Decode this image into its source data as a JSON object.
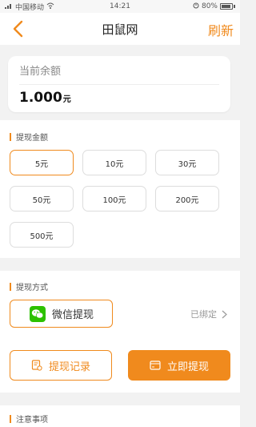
{
  "status_bar": {
    "carrier": "中国移动",
    "time": "14:21",
    "battery": "80%"
  },
  "nav": {
    "title": "田鼠网",
    "refresh": "刷新"
  },
  "balance": {
    "label": "当前余额",
    "amount": "1.000",
    "unit": "元"
  },
  "amount_section": {
    "title": "提现金额",
    "options": [
      "5元",
      "10元",
      "30元",
      "50元",
      "100元",
      "200元",
      "500元"
    ],
    "selected": "5元"
  },
  "method_section": {
    "title": "提现方式",
    "wechat_label": "微信提现",
    "bound_text": "已绑定"
  },
  "actions": {
    "record_label": "提现记录",
    "withdraw_label": "立即提现"
  },
  "notes_section": {
    "title": "注意事项"
  },
  "colors": {
    "accent": "#f08a1d",
    "wechat_green": "#2dc100",
    "background": "#f2f2f2"
  }
}
